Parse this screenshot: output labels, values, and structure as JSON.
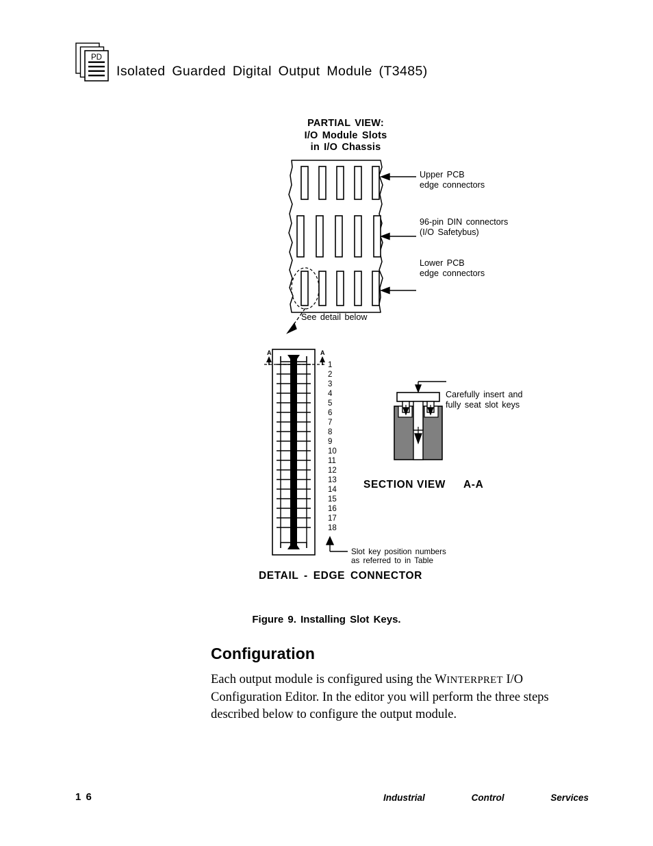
{
  "header": {
    "icon": "pd-document-stack-icon",
    "icon_label": "PD",
    "title": "Isolated  Guarded  Digital  Output  Module (T3485)"
  },
  "figure": {
    "partial_view": {
      "title_line1": "PARTIAL VIEW:",
      "title_line2": "I/O Module Slots",
      "title_line3": "in I/O Chassis",
      "slot_rows": 3,
      "slots_per_row": 5,
      "callouts": [
        {
          "name": "upper-pcb",
          "line1": "Upper  PCB",
          "line2": "edge  connectors"
        },
        {
          "name": "din-connectors",
          "line1": "96-pin  DIN  connectors",
          "line2": "(I/O  Safetybus)"
        },
        {
          "name": "lower-pcb",
          "line1": "Lower  PCB",
          "line2": "edge  connectors"
        }
      ],
      "see_detail": "See  detail  below"
    },
    "edge_connector": {
      "label": "DETAIL - EDGE CONNECTOR",
      "section_marker_left": "A",
      "section_marker_right": "A",
      "positions": [
        "1",
        "2",
        "3",
        "4",
        "5",
        "6",
        "7",
        "8",
        "9",
        "10",
        "11",
        "12",
        "13",
        "14",
        "15",
        "16",
        "17",
        "18"
      ],
      "position_note_line1": "Slot  key  position  numbers",
      "position_note_line2": "as  referred  to  in  Table"
    },
    "section_view": {
      "label": "SECTION  VIEW",
      "label_aa": "A-A",
      "callout_line1": "Carefully  insert  and",
      "callout_line2": "fully  seat  slot  keys",
      "block_color": "#808080"
    },
    "caption": "Figure 9.  Installing Slot Keys."
  },
  "configuration": {
    "heading": "Configuration",
    "body_part1": "Each output module is configured using the ",
    "body_brand_first": "W",
    "body_brand_rest": "INTERPRET",
    "body_part2": " I/O Configuration Editor.  In the editor you will perform the three steps described below to configure the output module."
  },
  "footer": {
    "page_number": "1 6",
    "brand_word1": "Industrial",
    "brand_word2": "Control",
    "brand_word3": "Services"
  }
}
